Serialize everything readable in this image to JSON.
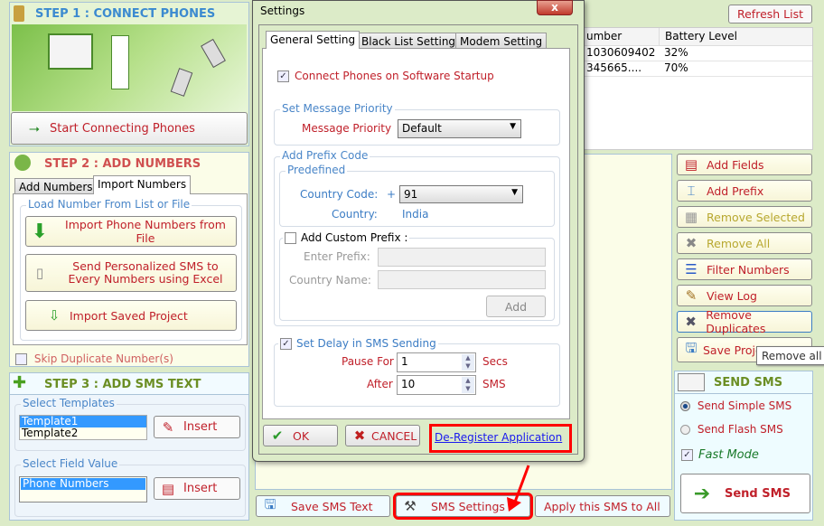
{
  "step1": {
    "title": "STEP 1 : CONNECT PHONES",
    "connect_button": "Start Connecting Phones"
  },
  "step2": {
    "title": "STEP 2 : ADD NUMBERS",
    "tabs": [
      "Add Numbers",
      "Import Numbers"
    ],
    "group": "Load Number From List or File",
    "buttons": [
      "Import Phone Numbers from File",
      "Send Personalized SMS to Every Numbers using Excel",
      "Import Saved Project"
    ],
    "skip_duplicates": "Skip Duplicate Number(s)",
    "skip_duplicates_checked": false
  },
  "step3": {
    "title": "STEP 3 : ADD SMS TEXT",
    "templates_label": "Select Templates",
    "templates": [
      "Template1",
      "Template2"
    ],
    "insert": "Insert",
    "field_label": "Select Field Value",
    "fields": [
      "Phone Numbers"
    ]
  },
  "phones": {
    "refresh": "Refresh List",
    "columns": [
      "umber",
      "Battery Level"
    ],
    "rows": [
      [
        "1030609402",
        "32%"
      ],
      [
        "345665....",
        "70%"
      ]
    ]
  },
  "actions": [
    "Add Fields",
    "Add Prefix",
    "Remove Selected",
    "Remove All",
    "Filter Numbers",
    "View Log",
    "Remove Duplicates",
    "Save Proje"
  ],
  "tooltip": "Remove all du",
  "send": {
    "title": "SEND SMS",
    "simple": "Send Simple SMS",
    "flash": "Send Flash SMS",
    "fast_mode": "Fast Mode",
    "fast_mode_checked": true,
    "selected": "simple",
    "button": "Send SMS"
  },
  "bottom": {
    "save": "Save SMS Text",
    "settings": "SMS Settings",
    "apply": "Apply this SMS to All"
  },
  "dialog": {
    "title": "Settings",
    "close": "x",
    "tabs": [
      "General Setting",
      "Black List Setting",
      "Modem Setting"
    ],
    "connect_startup": "Connect Phones on Software Startup",
    "connect_startup_checked": true,
    "priority_group": "Set Message Priority",
    "priority_label": "Message Priority",
    "priority_value": "Default",
    "prefix_group": "Add Prefix Code",
    "predefined": "Predefined",
    "country_code_label": "Country Code:",
    "plus": "+",
    "country_code": "91",
    "country_label": "Country:",
    "country": "India",
    "custom_prefix": "Add Custom Prefix :",
    "custom_prefix_checked": false,
    "enter_prefix": "Enter Prefix:",
    "country_name": "Country Name:",
    "add": "Add",
    "delay": "Set Delay in SMS Sending",
    "delay_checked": true,
    "pause_for": "Pause For",
    "pause_value": "1",
    "secs": "Secs",
    "after": "After",
    "after_value": "10",
    "sms": "SMS",
    "ok": "OK",
    "cancel": "CANCEL",
    "deregister": "De-Register Application"
  },
  "colors": {
    "highlight": "#ff0000",
    "header_red": "#d04040",
    "header_green": "#6b8e23"
  }
}
